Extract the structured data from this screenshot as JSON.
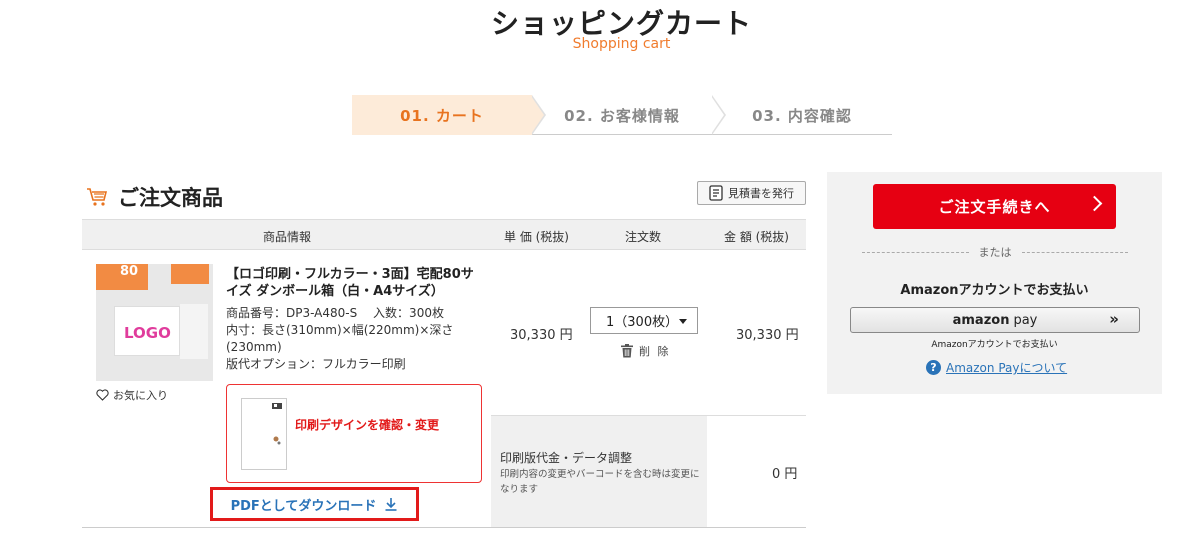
{
  "page": {
    "title": "ショッピングカート",
    "subtitle": "Shopping cart"
  },
  "steps": [
    {
      "label": "01. カート",
      "active": true
    },
    {
      "label": "02. お客様情報",
      "active": false
    },
    {
      "label": "03. 内容確認",
      "active": false
    }
  ],
  "section": {
    "title": "ご注文商品",
    "quote_button": "見積書を発行"
  },
  "table": {
    "headers": {
      "product": "商品情報",
      "unit_price": "単 価 (税抜)",
      "quantity": "注文数",
      "amount": "金 額 (税抜)"
    }
  },
  "item": {
    "name": "【ロゴ印刷・フルカラー・3面】宅配80サイズ ダンボール箱（白・A4サイズ）",
    "product_number": "商品番号：DP3-A480-S　 入数：300枚",
    "dimensions": "内寸：長さ(310mm)×幅(220mm)×深さ(230mm)",
    "plate_option": "版代オプション：フルカラー印刷",
    "unit_price": "30,330 円",
    "quantity_selected": "1（300枚）",
    "amount": "30,330 円",
    "favorite_label": "お気に入り",
    "delete_label": "削 除",
    "thumb_badge": "80",
    "thumb_logo": "LOGO",
    "design_link": "印刷デザインを確認・変更",
    "pdf_download": "PDFとしてダウンロード"
  },
  "option_row": {
    "title": "印刷版代金・データ調整",
    "note": "印刷内容の変更やバーコードを含む時は変更になります",
    "amount": "0 円"
  },
  "sidebar": {
    "checkout_label": "ご注文手続きへ",
    "or_label": "または",
    "amazon_title": "Amazonアカウントでお支払い",
    "amazon_button_brand": "amazon",
    "amazon_button_pay": "pay",
    "amazon_sub": "Amazonアカウントでお支払い",
    "amazon_help": "Amazon Payについて"
  },
  "colors": {
    "accent_orange": "#e8731f",
    "checkout_red": "#e60012",
    "link_blue": "#2a73b8"
  }
}
